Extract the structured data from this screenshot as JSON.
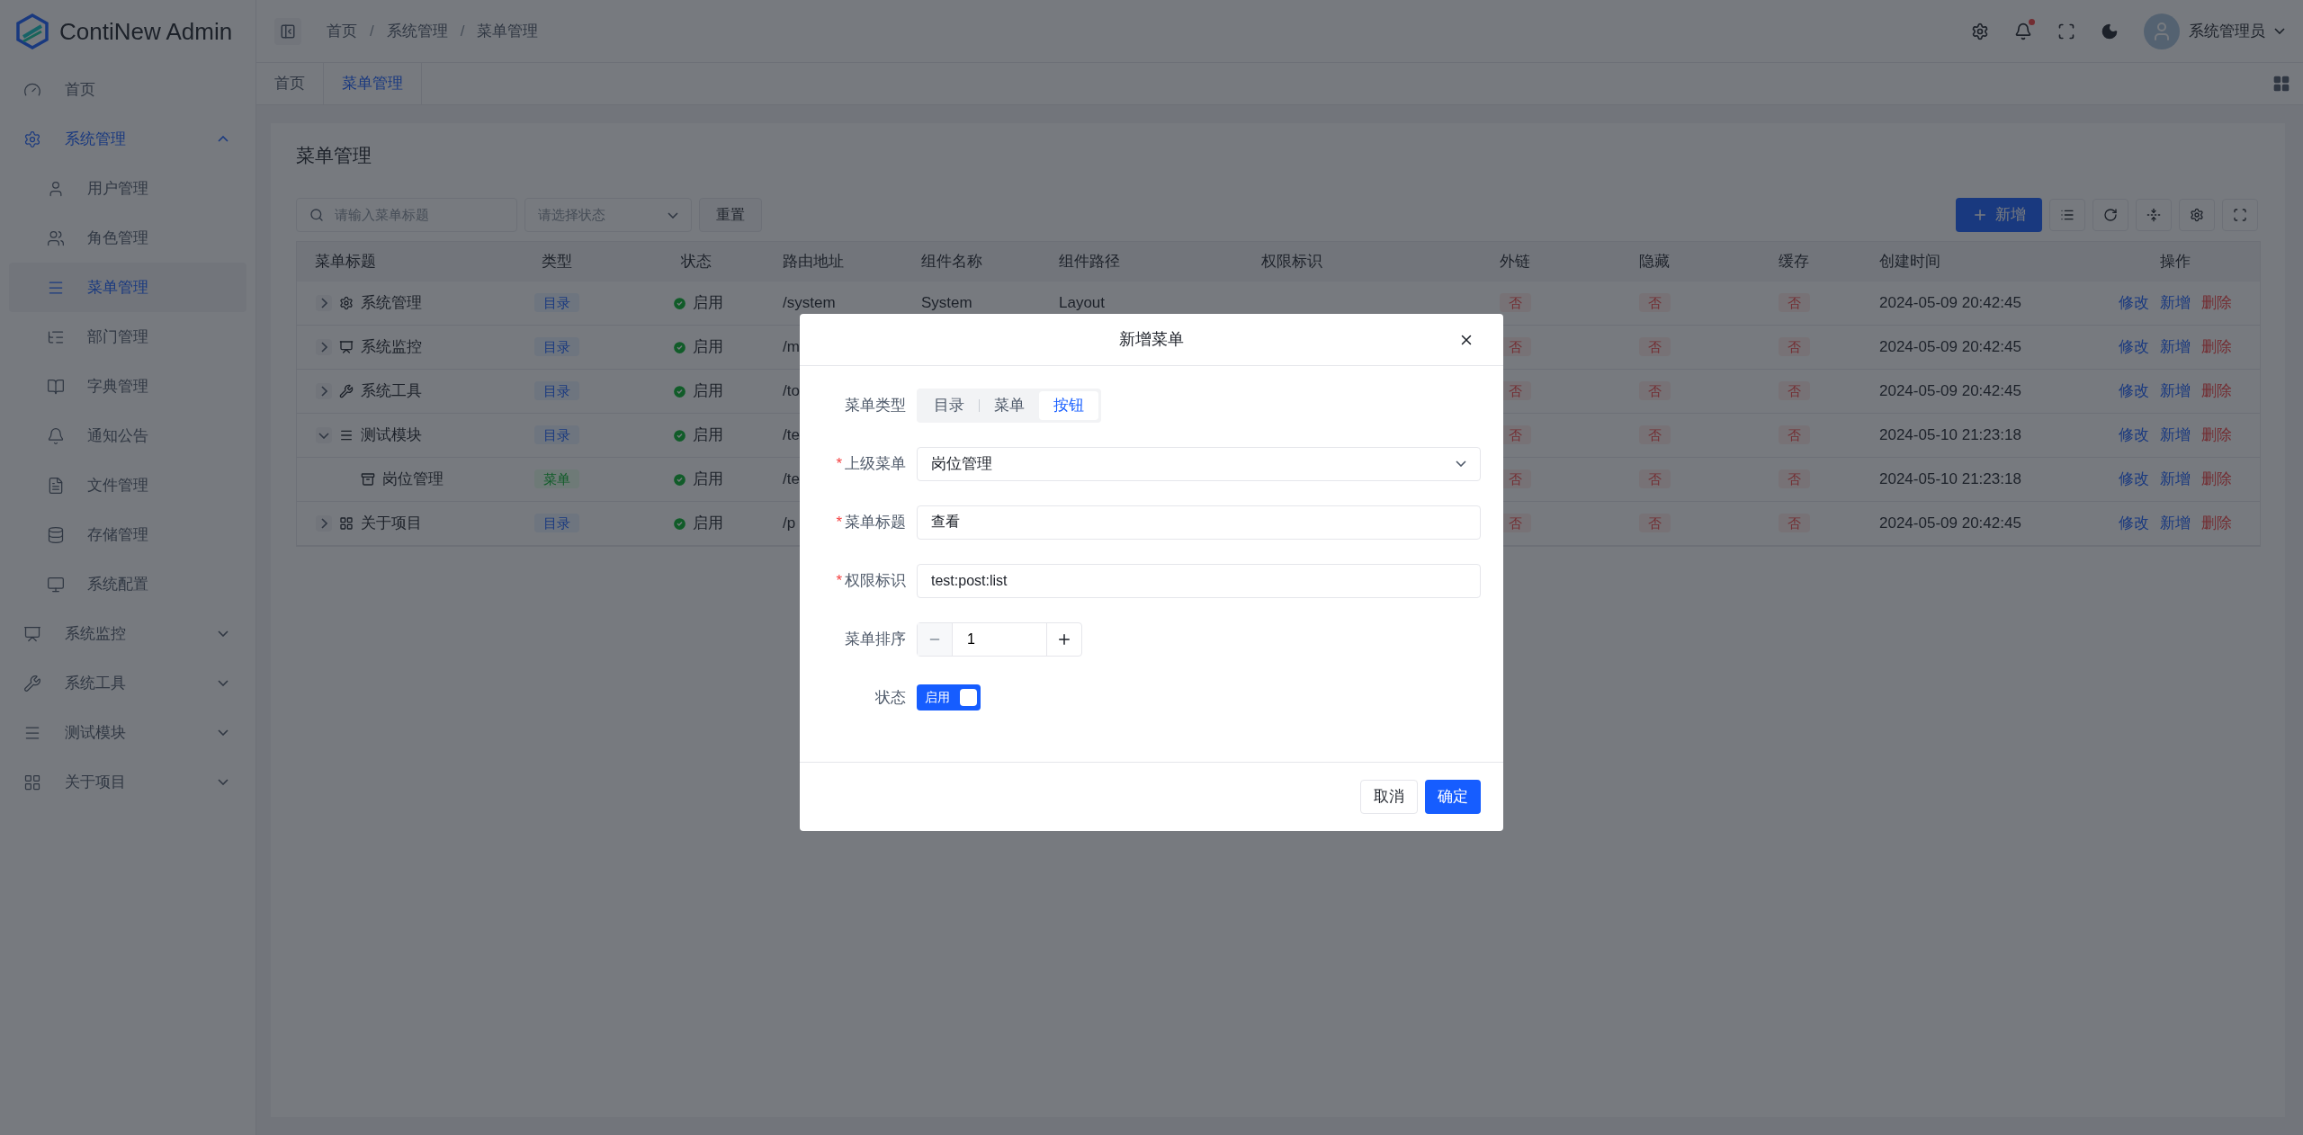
{
  "app": {
    "logo_text": "ContiNew Admin"
  },
  "header": {
    "breadcrumb": [
      "首页",
      "系统管理",
      "菜单管理"
    ],
    "breadcrumb_separators": [
      "/",
      "/"
    ],
    "user_name": "系统管理员"
  },
  "sidebar": {
    "items": [
      {
        "label": "首页",
        "selected": false
      },
      {
        "label": "系统管理",
        "expanded": true,
        "children": [
          {
            "label": "用户管理",
            "selected": false
          },
          {
            "label": "角色管理",
            "selected": false
          },
          {
            "label": "菜单管理",
            "selected": true
          },
          {
            "label": "部门管理",
            "selected": false
          },
          {
            "label": "字典管理",
            "selected": false
          },
          {
            "label": "通知公告",
            "selected": false
          },
          {
            "label": "文件管理",
            "selected": false
          },
          {
            "label": "存储管理",
            "selected": false
          },
          {
            "label": "系统配置",
            "selected": false
          }
        ]
      },
      {
        "label": "系统监控",
        "expanded": false
      },
      {
        "label": "系统工具",
        "expanded": false
      },
      {
        "label": "测试模块",
        "expanded": false
      },
      {
        "label": "关于项目",
        "expanded": false
      }
    ]
  },
  "tabs": [
    {
      "label": "首页",
      "selected": false
    },
    {
      "label": "菜单管理",
      "selected": true
    }
  ],
  "page": {
    "title": "菜单管理",
    "search": {
      "placeholder": "请输入菜单标题"
    },
    "status_select": {
      "placeholder": "请选择状态"
    },
    "reset_button": "重置",
    "add_button": "新增"
  },
  "table": {
    "columns": [
      "菜单标题",
      "类型",
      "状态",
      "路由地址",
      "组件名称",
      "组件路径",
      "权限标识",
      "外链",
      "隐藏",
      "缓存",
      "创建时间",
      "操作"
    ],
    "rows": [
      {
        "title": "系统管理",
        "expanded": false,
        "type": {
          "label": "目录",
          "kind": "directory"
        },
        "status": "启用",
        "route": "/system",
        "component": "System",
        "path": "Layout",
        "external": "否",
        "hidden": "否",
        "cache": "否",
        "created": "2024-05-09 20:42:45",
        "actions": [
          {
            "label": "修改",
            "kind": "normal"
          },
          {
            "label": "新增",
            "kind": "normal"
          },
          {
            "label": "删除",
            "kind": "danger"
          }
        ]
      },
      {
        "title": "系统监控",
        "expanded": false,
        "type": {
          "label": "目录",
          "kind": "directory"
        },
        "status": "启用",
        "route": "/m",
        "external": "否",
        "hidden": "否",
        "cache": "否",
        "created": "2024-05-09 20:42:45",
        "actions": [
          {
            "label": "修改",
            "kind": "normal"
          },
          {
            "label": "新增",
            "kind": "normal"
          },
          {
            "label": "删除",
            "kind": "danger"
          }
        ]
      },
      {
        "title": "系统工具",
        "expanded": false,
        "type": {
          "label": "目录",
          "kind": "directory"
        },
        "status": "启用",
        "route": "/to",
        "external": "否",
        "hidden": "否",
        "cache": "否",
        "created": "2024-05-09 20:42:45",
        "actions": [
          {
            "label": "修改",
            "kind": "normal"
          },
          {
            "label": "新增",
            "kind": "normal"
          },
          {
            "label": "删除",
            "kind": "danger"
          }
        ]
      },
      {
        "title": "测试模块",
        "expanded": true,
        "type": {
          "label": "目录",
          "kind": "directory"
        },
        "status": "启用",
        "route": "/te",
        "external": "否",
        "hidden": "否",
        "cache": "否",
        "created": "2024-05-10 21:23:18",
        "actions": [
          {
            "label": "修改",
            "kind": "normal"
          },
          {
            "label": "新增",
            "kind": "normal"
          },
          {
            "label": "删除",
            "kind": "danger"
          }
        ],
        "children": [
          {
            "title": "岗位管理",
            "type": {
              "label": "菜单",
              "kind": "menu"
            },
            "status": "启用",
            "route": "/te",
            "external": "否",
            "hidden": "否",
            "cache": "否",
            "created": "2024-05-10 21:23:18",
            "actions": [
              {
                "label": "修改",
                "kind": "normal"
              },
              {
                "label": "新增",
                "kind": "normal"
              },
              {
                "label": "删除",
                "kind": "danger"
              }
            ]
          }
        ]
      },
      {
        "title": "关于项目",
        "expanded": false,
        "type": {
          "label": "目录",
          "kind": "directory"
        },
        "status": "启用",
        "route": "/p",
        "external": "否",
        "hidden": "否",
        "cache": "否",
        "created": "2024-05-09 20:42:45",
        "actions": [
          {
            "label": "修改",
            "kind": "normal"
          },
          {
            "label": "新增",
            "kind": "normal"
          },
          {
            "label": "删除",
            "kind": "danger"
          }
        ]
      }
    ]
  },
  "dialog": {
    "title": "新增菜单",
    "fields": [
      {
        "kind": "segmented",
        "label": "菜单类型",
        "options": [
          {
            "label": "目录",
            "selected": false
          },
          {
            "label": "菜单",
            "selected": false
          },
          {
            "label": "按钮",
            "selected": true
          }
        ]
      },
      {
        "kind": "select",
        "label": "上级菜单",
        "required_mark": "*",
        "value": "岗位管理"
      },
      {
        "kind": "input",
        "label": "菜单标题",
        "required_mark": "*",
        "value": "查看"
      },
      {
        "kind": "input",
        "label": "权限标识",
        "required_mark": "*",
        "value": "test:post:list"
      },
      {
        "kind": "number",
        "label": "菜单排序",
        "value": "1"
      },
      {
        "kind": "switch",
        "label": "状态",
        "on": true,
        "text": "启用"
      }
    ],
    "buttons": [
      {
        "label": "取消",
        "kind": "secondary"
      },
      {
        "label": "确定",
        "kind": "primary"
      }
    ]
  }
}
